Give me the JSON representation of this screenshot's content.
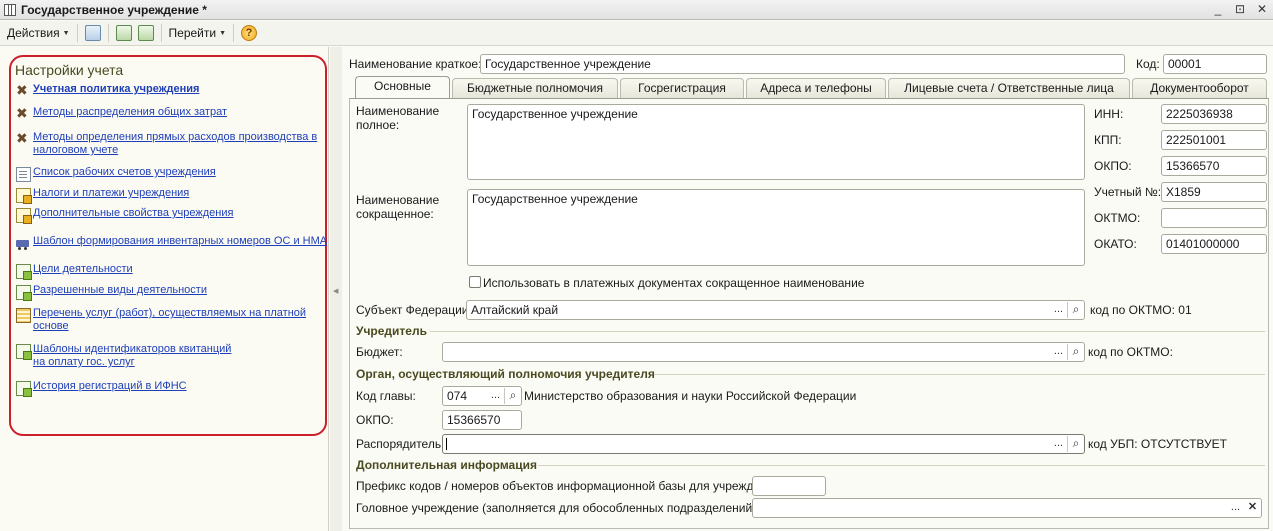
{
  "window": {
    "title": "Государственное учреждение *",
    "buttons": [
      "_",
      "⊡",
      "✕"
    ]
  },
  "toolbar": {
    "actions_label": "Действия",
    "goto_label": "Перейти",
    "help_icon": "?"
  },
  "left_panel": {
    "title": "Настройки учета",
    "items": [
      {
        "label": "Учетная политика учреждения",
        "icon": "tools-icon"
      },
      {
        "label": "Методы распределения общих затрат",
        "icon": "tools-icon"
      },
      {
        "label": "Методы определения прямых расходов производства в налоговом учете",
        "icon": "tools-icon"
      },
      {
        "label": "Список рабочих счетов учреждения",
        "icon": "document-icon"
      },
      {
        "label": "Налоги и платежи учреждения",
        "icon": "document-icon"
      },
      {
        "label": "Дополнительные свойства учреждения",
        "icon": "properties-icon"
      },
      {
        "label": "Шаблон формирования инвентарных номеров ОС и НМА",
        "icon": "truck-icon"
      },
      {
        "label": "Цели деятельности",
        "icon": "catalog-icon"
      },
      {
        "label": "Разрешенные виды деятельности",
        "icon": "catalog-icon"
      },
      {
        "label": "Перечень услуг (работ), осуществляемых на платной основе",
        "icon": "register-icon"
      },
      {
        "label": "Шаблоны идентификаторов квитанций на оплату гос. услуг",
        "icon": "catalog-icon"
      },
      {
        "label": "История регистраций в ИФНС",
        "icon": "catalog-icon"
      }
    ]
  },
  "header": {
    "short_name_label": "Наименование краткое:",
    "short_name_value": "Государственное учреждение",
    "code_label": "Код:",
    "code_value": "00001"
  },
  "tabs": [
    {
      "label": "Основные",
      "active": true
    },
    {
      "label": "Бюджетные полномочия",
      "active": false
    },
    {
      "label": "Госрегистрация",
      "active": false
    },
    {
      "label": "Адреса и телефоны",
      "active": false
    },
    {
      "label": "Лицевые счета / Ответственные лица",
      "active": false
    },
    {
      "label": "Документооборот",
      "active": false
    }
  ],
  "main": {
    "full_name_label": "Наименование полное:",
    "full_name_value": "Государственное учреждение",
    "abbr_name_label": "Наименование сокращенное:",
    "abbr_name_value": "Государственное учреждение",
    "use_abbr_checkbox_label": "Использовать в платежных документах сокращенное наименование",
    "use_abbr_checked": false,
    "inn_label": "ИНН:",
    "inn_value": "2225036938",
    "kpp_label": "КПП:",
    "kpp_value": "222501001",
    "okpo_label": "ОКПО:",
    "okpo_value": "15366570",
    "reg_num_label": "Учетный №:",
    "reg_num_value": "Х1859",
    "oktmo_label": "ОКТМО:",
    "oktmo_value": "",
    "okato_label": "ОКАТО:",
    "okato_value": "01401000000",
    "subject_label": "Субъект Федерации:",
    "subject_value": "Алтайский край",
    "subject_oktmo_note": "код по ОКТМО: 01"
  },
  "founder": {
    "section_title": "Учредитель",
    "budget_label": "Бюджет:",
    "budget_value": "",
    "budget_oktmo_note": "код по ОКТМО:"
  },
  "authority": {
    "section_title": "Орган, осуществляющий полномочия учредителя",
    "head_code_label": "Код главы:",
    "head_code_value": "074",
    "head_code_name": "Министерство образования и науки Российской Федерации",
    "okpo_label": "ОКПО:",
    "okpo_value": "15366570",
    "manager_label": "Распорядитель:",
    "manager_value": "",
    "ubp_note": "код УБП: ОТСУТСТВУЕТ"
  },
  "extra": {
    "section_title": "Дополнительная информация",
    "prefix_label": "Префикс кодов / номеров объектов информационной базы для учреждения:",
    "prefix_value": "",
    "head_org_label": "Головное учреждение (заполняется для обособленных подразделений):",
    "head_org_value": ""
  },
  "colors": {
    "link": "#1f3fb8",
    "section_title": "#4a4a20",
    "highlight_frame": "#cc1f2a",
    "background": "#fbfbf6"
  }
}
